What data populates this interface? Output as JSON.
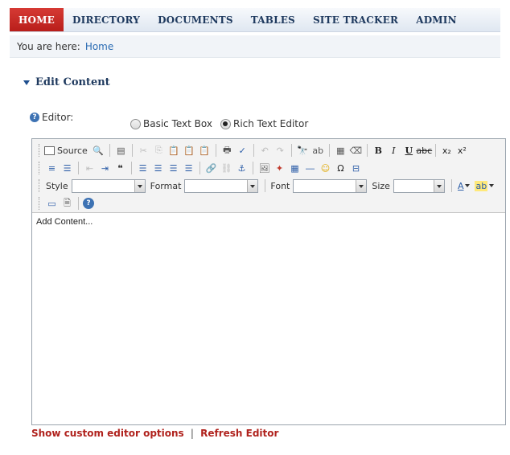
{
  "nav": {
    "items": [
      {
        "label": "HOME",
        "active": true
      },
      {
        "label": "DIRECTORY",
        "active": false
      },
      {
        "label": "DOCUMENTS",
        "active": false
      },
      {
        "label": "TABLES",
        "active": false
      },
      {
        "label": "SITE TRACKER",
        "active": false
      },
      {
        "label": "ADMIN",
        "active": false
      }
    ]
  },
  "breadcrumb": {
    "prefix": "You are here:",
    "current": "Home"
  },
  "section": {
    "title": "Edit Content"
  },
  "editor_field": {
    "label": "Editor:",
    "options": [
      {
        "label": "Basic Text Box",
        "checked": false
      },
      {
        "label": "Rich Text Editor",
        "checked": true
      }
    ]
  },
  "toolbar": {
    "source_label": "Source",
    "style_label": "Style",
    "format_label": "Format",
    "font_label": "Font",
    "size_label": "Size"
  },
  "content": {
    "text": "Add Content..."
  },
  "footer": {
    "custom_options_label": "Show custom editor options",
    "separator": "|",
    "refresh_label": "Refresh Editor"
  },
  "colors": {
    "accent_red": "#b0221d",
    "nav_text": "#1f3a5f",
    "link_blue": "#2a6bb3"
  }
}
